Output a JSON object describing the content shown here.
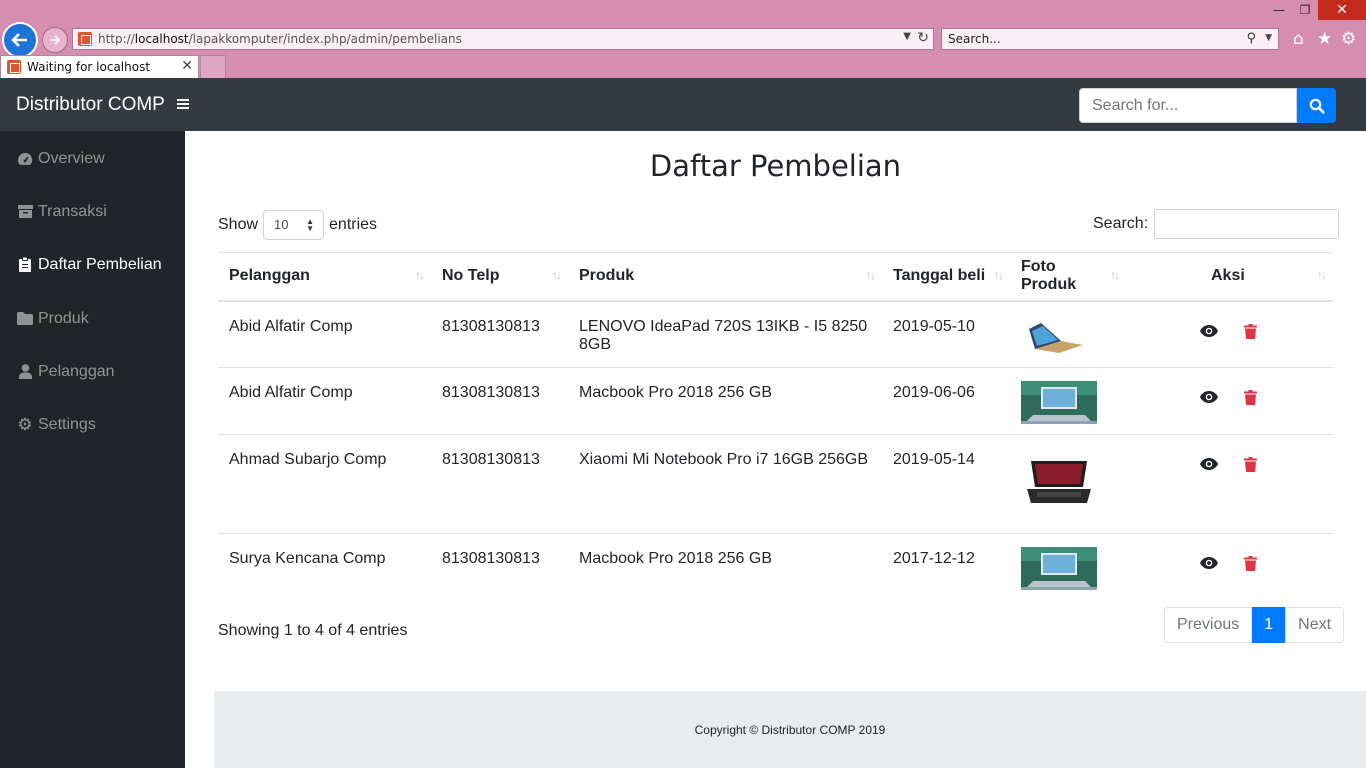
{
  "browser": {
    "address": {
      "scheme": "http://",
      "host": "localhost",
      "path": "/lapakkomputer/index.php/admin/pembelians"
    },
    "search_placeholder": "Search...",
    "tab_title": "Waiting for localhost"
  },
  "navbar": {
    "brand": "Distributor COMP",
    "search_placeholder": "Search for..."
  },
  "sidebar": {
    "items": [
      {
        "label": "Overview",
        "icon": "tachometer-icon"
      },
      {
        "label": "Transaksi",
        "icon": "archive-icon"
      },
      {
        "label": "Daftar Pembelian",
        "icon": "clipboard-icon",
        "active": true
      },
      {
        "label": "Produk",
        "icon": "folder-icon"
      },
      {
        "label": "Pelanggan",
        "icon": "user-icon"
      },
      {
        "label": "Settings",
        "icon": "gear-icon"
      }
    ]
  },
  "main": {
    "title": "Daftar Pembelian",
    "show_label": "Show",
    "entries_value": "10",
    "entries_label": "entries",
    "search_label": "Search:",
    "columns": [
      "Pelanggan",
      "No Telp",
      "Produk",
      "Tanggal beli",
      "Foto Produk",
      "Aksi"
    ],
    "rows": [
      {
        "pelanggan": "Abid Alfatir Comp",
        "telp": "81308130813",
        "produk": "LENOVO IdeaPad 720S 13IKB - I5 8250 8GB",
        "tanggal": "2019-05-10",
        "foto": "lenovo-laptop-image"
      },
      {
        "pelanggan": "Abid Alfatir Comp",
        "telp": "81308130813",
        "produk": "Macbook Pro 2018 256 GB",
        "tanggal": "2019-06-06",
        "foto": "macbook-image"
      },
      {
        "pelanggan": "Ahmad Subarjo Comp",
        "telp": "81308130813",
        "produk": "Xiaomi Mi Notebook Pro i7 16GB 256GB",
        "tanggal": "2019-05-14",
        "foto": "xiaomi-laptop-image"
      },
      {
        "pelanggan": "Surya Kencana Comp",
        "telp": "81308130813",
        "produk": "Macbook Pro 2018 256 GB",
        "tanggal": "2017-12-12",
        "foto": "macbook-image"
      }
    ],
    "info": "Showing 1 to 4 of 4 entries",
    "pagination": {
      "previous": "Previous",
      "current": "1",
      "next": "Next"
    }
  },
  "footer": {
    "copyright": "Copyright © Distributor COMP 2019"
  },
  "colors": {
    "primary": "#007bff",
    "danger": "#dc3545",
    "navbar": "#343a40",
    "sidebar": "#212529",
    "chrome": "#d58db0"
  }
}
